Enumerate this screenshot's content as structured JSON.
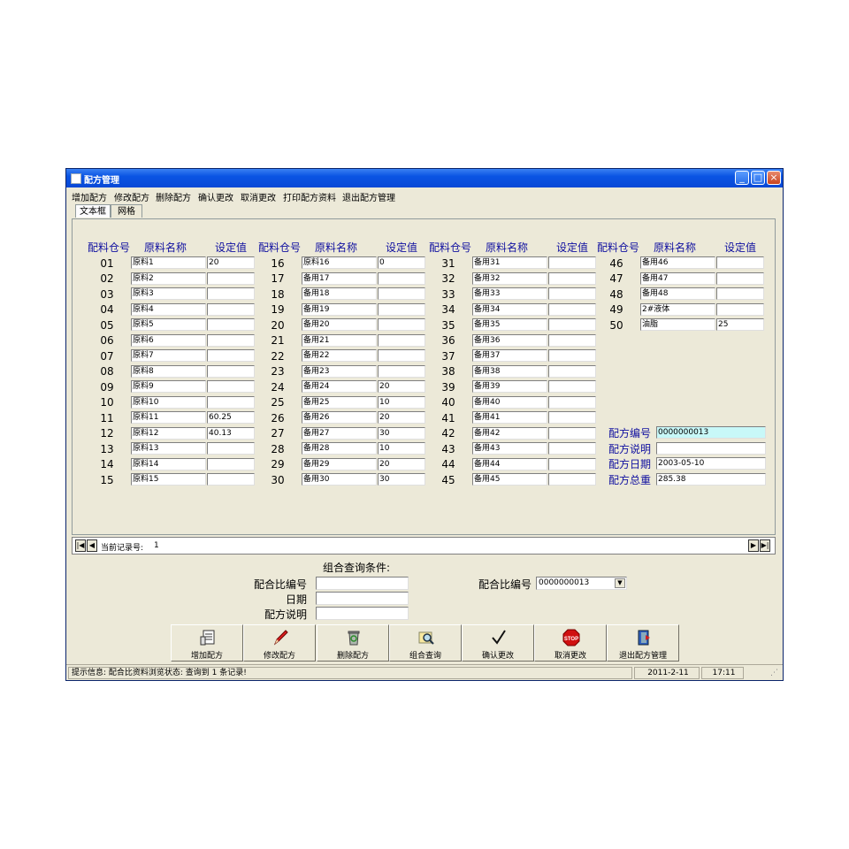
{
  "window": {
    "title": "配方管理",
    "min": "_",
    "max": "□",
    "close": "×"
  },
  "menu": [
    "增加配方",
    "修改配方",
    "删除配方",
    "确认更改",
    "取消更改",
    "打印配方资料",
    "退出配方管理"
  ],
  "tabs": [
    "文本框",
    "网格"
  ],
  "headers": {
    "bin": "配料仓号",
    "name": "原料名称",
    "value": "设定值"
  },
  "rows": [
    {
      "no": "01",
      "name": "原料1",
      "value": "20"
    },
    {
      "no": "02",
      "name": "原料2",
      "value": ""
    },
    {
      "no": "03",
      "name": "原料3",
      "value": ""
    },
    {
      "no": "04",
      "name": "原料4",
      "value": ""
    },
    {
      "no": "05",
      "name": "原料5",
      "value": ""
    },
    {
      "no": "06",
      "name": "原料6",
      "value": ""
    },
    {
      "no": "07",
      "name": "原料7",
      "value": ""
    },
    {
      "no": "08",
      "name": "原料8",
      "value": ""
    },
    {
      "no": "09",
      "name": "原料9",
      "value": ""
    },
    {
      "no": "10",
      "name": "原料10",
      "value": ""
    },
    {
      "no": "11",
      "name": "原料11",
      "value": "60.25"
    },
    {
      "no": "12",
      "name": "原料12",
      "value": "40.13"
    },
    {
      "no": "13",
      "name": "原料13",
      "value": ""
    },
    {
      "no": "14",
      "name": "原料14",
      "value": ""
    },
    {
      "no": "15",
      "name": "原料15",
      "value": ""
    },
    {
      "no": "16",
      "name": "原料16",
      "value": "0"
    },
    {
      "no": "17",
      "name": "备用17",
      "value": ""
    },
    {
      "no": "18",
      "name": "备用18",
      "value": ""
    },
    {
      "no": "19",
      "name": "备用19",
      "value": ""
    },
    {
      "no": "20",
      "name": "备用20",
      "value": ""
    },
    {
      "no": "21",
      "name": "备用21",
      "value": ""
    },
    {
      "no": "22",
      "name": "备用22",
      "value": ""
    },
    {
      "no": "23",
      "name": "备用23",
      "value": ""
    },
    {
      "no": "24",
      "name": "备用24",
      "value": "20"
    },
    {
      "no": "25",
      "name": "备用25",
      "value": "10"
    },
    {
      "no": "26",
      "name": "备用26",
      "value": "20"
    },
    {
      "no": "27",
      "name": "备用27",
      "value": "30"
    },
    {
      "no": "28",
      "name": "备用28",
      "value": "10"
    },
    {
      "no": "29",
      "name": "备用29",
      "value": "20"
    },
    {
      "no": "30",
      "name": "备用30",
      "value": "30"
    },
    {
      "no": "31",
      "name": "备用31",
      "value": ""
    },
    {
      "no": "32",
      "name": "备用32",
      "value": ""
    },
    {
      "no": "33",
      "name": "备用33",
      "value": ""
    },
    {
      "no": "34",
      "name": "备用34",
      "value": ""
    },
    {
      "no": "35",
      "name": "备用35",
      "value": ""
    },
    {
      "no": "36",
      "name": "备用36",
      "value": ""
    },
    {
      "no": "37",
      "name": "备用37",
      "value": ""
    },
    {
      "no": "38",
      "name": "备用38",
      "value": ""
    },
    {
      "no": "39",
      "name": "备用39",
      "value": ""
    },
    {
      "no": "40",
      "name": "备用40",
      "value": ""
    },
    {
      "no": "41",
      "name": "备用41",
      "value": ""
    },
    {
      "no": "42",
      "name": "备用42",
      "value": ""
    },
    {
      "no": "43",
      "name": "备用43",
      "value": ""
    },
    {
      "no": "44",
      "name": "备用44",
      "value": ""
    },
    {
      "no": "45",
      "name": "备用45",
      "value": ""
    },
    {
      "no": "46",
      "name": "备用46",
      "value": ""
    },
    {
      "no": "47",
      "name": "备用47",
      "value": ""
    },
    {
      "no": "48",
      "name": "备用48",
      "value": ""
    },
    {
      "no": "49",
      "name": "2#液体",
      "value": ""
    },
    {
      "no": "50",
      "name": "油脂",
      "value": "25"
    }
  ],
  "recipe": {
    "id_label": "配方编号",
    "id": "0000000013",
    "desc_label": "配方说明",
    "desc": "",
    "date_label": "配方日期",
    "date": "2003-05-10",
    "total_label": "配方总重",
    "total": "285.38"
  },
  "nav": {
    "record_label": "当前记录号:",
    "record": "1",
    "first": "|◀",
    "prev": "◀",
    "next": "▶",
    "last": "▶|"
  },
  "query": {
    "title": "组合查询条件:",
    "ratio_label": "配合比编号",
    "ratio_value": "",
    "date_label": "日期",
    "date_value": "",
    "desc_label": "配方说明",
    "desc_value": "",
    "combo_label": "配合比编号",
    "combo_value": "0000000013"
  },
  "actions": [
    {
      "label": "增加配方",
      "icon": "document-add-icon"
    },
    {
      "label": "修改配方",
      "icon": "pencil-icon"
    },
    {
      "label": "删除配方",
      "icon": "recycle-bin-icon"
    },
    {
      "label": "组合查询",
      "icon": "search-folder-icon"
    },
    {
      "label": "确认更改",
      "icon": "checkmark-icon"
    },
    {
      "label": "取消更改",
      "icon": "stop-icon"
    },
    {
      "label": "退出配方管理",
      "icon": "exit-door-icon"
    }
  ],
  "stop_text": "STOP",
  "status": {
    "message": "提示信息: 配合比资料浏览状态: 查询到  1 条记录!",
    "date": "2011-2-11",
    "time": "17:11"
  }
}
